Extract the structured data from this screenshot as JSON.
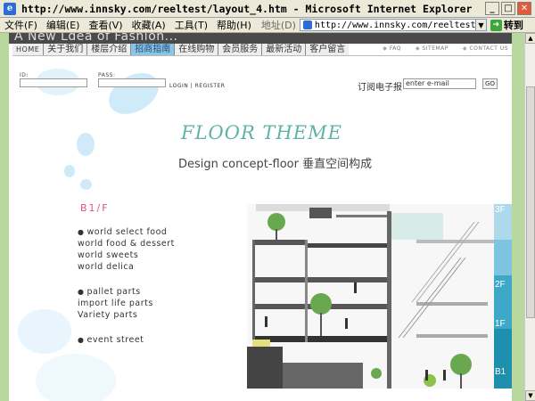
{
  "window": {
    "title": "http://www.innsky.com/reeltest/layout_4.htm - Microsoft Internet Explorer",
    "minimize": "_",
    "maximize": "□",
    "close": "✕"
  },
  "menu": {
    "items": [
      "文件(F)",
      "编辑(E)",
      "查看(V)",
      "收藏(A)",
      "工具(T)",
      "帮助(H)"
    ],
    "address_label": "地址(D)",
    "address_value": "http://www.innsky.com/reeltest/layout_4.htm",
    "go_label": "转到"
  },
  "banner": {
    "text": "A New Ldea of Fashion..."
  },
  "nav": {
    "items": [
      "HOME",
      "关于我们",
      "楼层介绍",
      "招商指南",
      "在线购物",
      "会员服务",
      "最新活动",
      "客户留言"
    ],
    "active_index": 3,
    "right_links": [
      "FAQ",
      "SITEMAP",
      "CONTACT US"
    ]
  },
  "login": {
    "id_label": "ID:",
    "pass_label": "PASS:",
    "login_link": "LOGIN",
    "separator": "|",
    "register_link": "REGISTER"
  },
  "subscribe": {
    "label": "订阅电子报",
    "input_value": "enter e-mail",
    "go": "GO"
  },
  "content": {
    "title": "FLOOR THEME",
    "subtitle": "Design concept-floor  垂直空间构成",
    "floor_label": "B1/F",
    "group1": [
      "world select food",
      "world food & dessert",
      "world sweets",
      "world delica"
    ],
    "group2": [
      "pallet parts",
      "import life parts",
      "Variety parts"
    ],
    "group3": [
      "event street"
    ]
  },
  "diagram": {
    "floors": [
      "3F",
      "2F",
      "1F",
      "B1"
    ]
  },
  "colors": {
    "accent_teal": "#5fb3a6",
    "nav_active": "#8cc4e4",
    "floor_pink": "#e05588",
    "side_green": "#b9d8a0"
  }
}
